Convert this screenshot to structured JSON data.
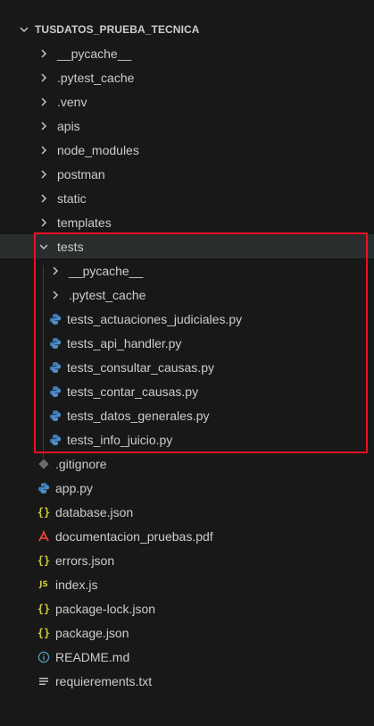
{
  "explorer": {
    "root_label": "TUSDATOS_PRUEBA_TECNICA",
    "items": [
      {
        "label": "__pycache__",
        "kind": "folder",
        "level": 1,
        "icon": "chevron-right-icon"
      },
      {
        "label": ".pytest_cache",
        "kind": "folder",
        "level": 1,
        "icon": "chevron-right-icon"
      },
      {
        "label": ".venv",
        "kind": "folder",
        "level": 1,
        "icon": "chevron-right-icon"
      },
      {
        "label": "apis",
        "kind": "folder",
        "level": 1,
        "icon": "chevron-right-icon"
      },
      {
        "label": "node_modules",
        "kind": "folder",
        "level": 1,
        "icon": "chevron-right-icon"
      },
      {
        "label": "postman",
        "kind": "folder",
        "level": 1,
        "icon": "chevron-right-icon"
      },
      {
        "label": "static",
        "kind": "folder",
        "level": 1,
        "icon": "chevron-right-icon"
      },
      {
        "label": "templates",
        "kind": "folder",
        "level": 1,
        "icon": "chevron-right-icon"
      },
      {
        "label": "tests",
        "kind": "folder-open",
        "level": 1,
        "icon": "chevron-down-icon"
      },
      {
        "label": "__pycache__",
        "kind": "folder",
        "level": 2,
        "icon": "chevron-right-icon"
      },
      {
        "label": ".pytest_cache",
        "kind": "folder",
        "level": 2,
        "icon": "chevron-right-icon"
      },
      {
        "label": "tests_actuaciones_judiciales.py",
        "kind": "python",
        "level": 2,
        "icon": "python-icon"
      },
      {
        "label": "tests_api_handler.py",
        "kind": "python",
        "level": 2,
        "icon": "python-icon"
      },
      {
        "label": "tests_consultar_causas.py",
        "kind": "python",
        "level": 2,
        "icon": "python-icon"
      },
      {
        "label": "tests_contar_causas.py",
        "kind": "python",
        "level": 2,
        "icon": "python-icon"
      },
      {
        "label": "tests_datos_generales.py",
        "kind": "python",
        "level": 2,
        "icon": "python-icon"
      },
      {
        "label": "tests_info_juicio.py",
        "kind": "python",
        "level": 2,
        "icon": "python-icon"
      },
      {
        "label": ".gitignore",
        "kind": "git",
        "level": 1,
        "icon": "git-icon"
      },
      {
        "label": "app.py",
        "kind": "python",
        "level": 1,
        "icon": "python-icon"
      },
      {
        "label": "database.json",
        "kind": "json",
        "level": 1,
        "icon": "json-icon"
      },
      {
        "label": "documentacion_pruebas.pdf",
        "kind": "pdf",
        "level": 1,
        "icon": "pdf-icon"
      },
      {
        "label": "errors.json",
        "kind": "json",
        "level": 1,
        "icon": "json-icon"
      },
      {
        "label": "index.js",
        "kind": "js",
        "level": 1,
        "icon": "js-icon"
      },
      {
        "label": "package-lock.json",
        "kind": "json",
        "level": 1,
        "icon": "json-icon"
      },
      {
        "label": "package.json",
        "kind": "json",
        "level": 1,
        "icon": "json-icon"
      },
      {
        "label": "README.md",
        "kind": "info",
        "level": 1,
        "icon": "info-icon"
      },
      {
        "label": "requierements.txt",
        "kind": "text",
        "level": 1,
        "icon": "text-lines-icon"
      }
    ],
    "colors": {
      "background": "#181818",
      "text": "#cccccc",
      "selected_row": "#2a2d2e",
      "highlight_border": "#e81123",
      "json_icon": "#cbcb41",
      "python_icon": "#3e7ab8",
      "pdf_icon": "#e5453d",
      "git_icon": "#6b6b6b",
      "info_icon": "#519aba"
    }
  }
}
